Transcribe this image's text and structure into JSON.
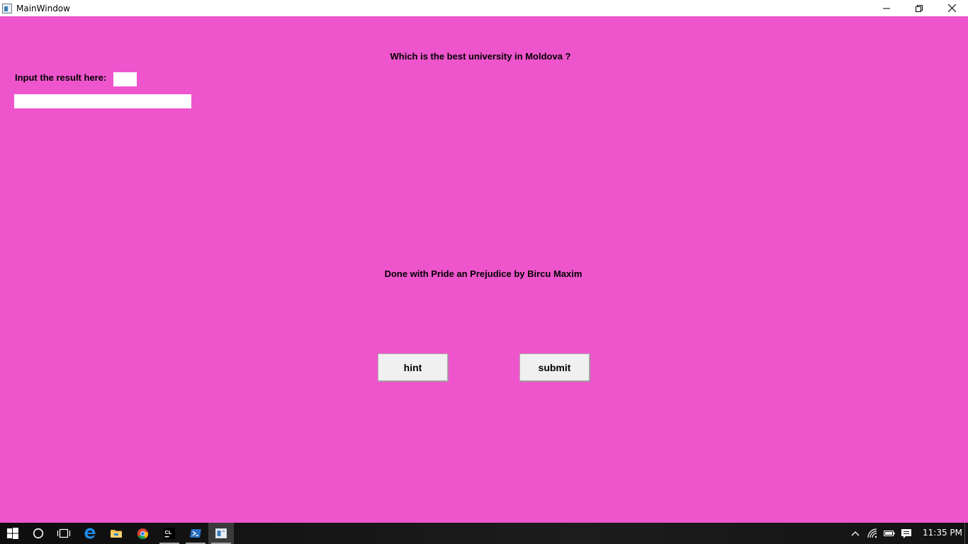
{
  "window": {
    "title": "MainWindow",
    "background_color": "#ee55cc"
  },
  "main": {
    "question": "Which is the best university in Moldova ?",
    "input_label": "Input the result here:",
    "small_input_value": "",
    "wide_input_value": "",
    "credit": "Done with Pride an Prejudice by Bircu Maxim",
    "hint_label": "hint",
    "submit_label": "submit"
  },
  "taskbar": {
    "items": [
      {
        "icon": "windows-start-icon"
      },
      {
        "icon": "cortana-search-icon"
      },
      {
        "icon": "task-view-icon"
      },
      {
        "icon": "edge-browser-icon"
      },
      {
        "icon": "file-explorer-icon"
      },
      {
        "icon": "chrome-browser-icon"
      },
      {
        "icon": "clion-icon",
        "text": "CL"
      },
      {
        "icon": "powershell-icon"
      },
      {
        "icon": "main-window-app-icon"
      }
    ],
    "clock": "11:35 PM"
  }
}
